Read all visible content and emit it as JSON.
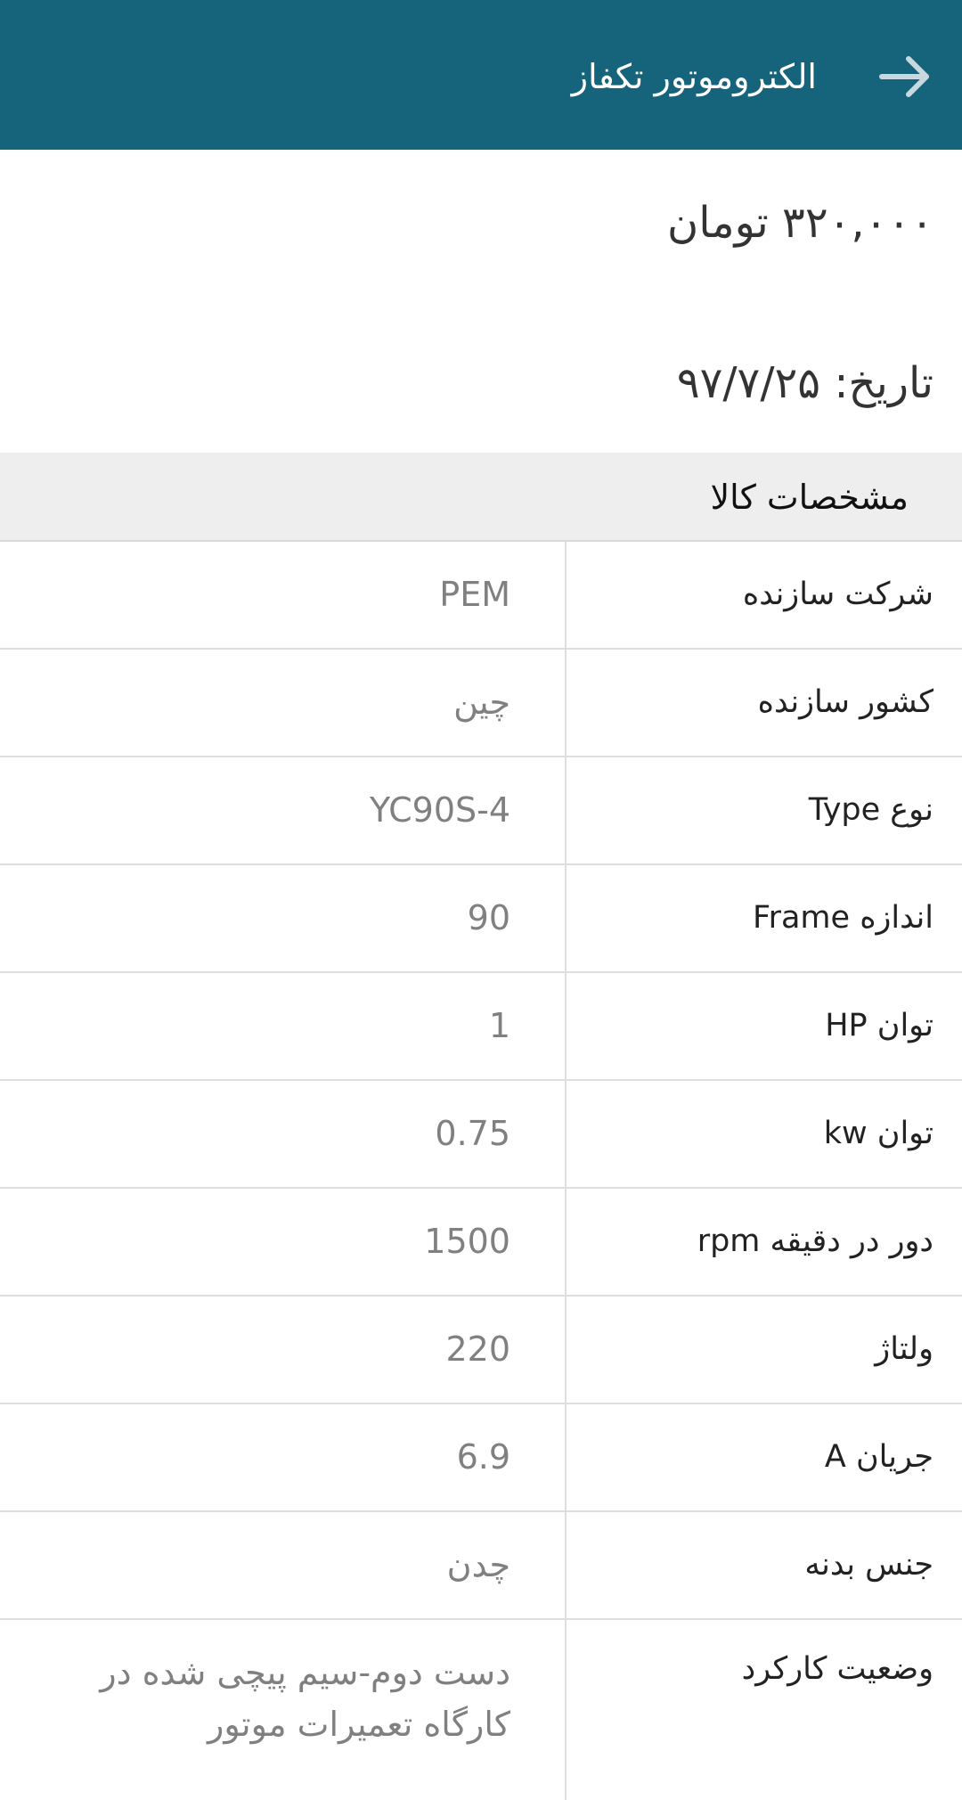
{
  "appbar": {
    "title": "الکتروموتور تکفاز",
    "back_icon": "arrow-right-icon"
  },
  "price": "۳۲۰,۰۰۰ تومان",
  "date": "تاریخ: ۹۷/۷/۲۵",
  "specs": {
    "header": "مشخصات کالا",
    "rows": [
      {
        "label": "شرکت سازنده",
        "value": "PEM"
      },
      {
        "label": "کشور سازنده",
        "value": "چین"
      },
      {
        "label": "نوع Type",
        "value": "YC90S-4"
      },
      {
        "label": "اندازه Frame",
        "value": "90"
      },
      {
        "label": "توان HP",
        "value": "1"
      },
      {
        "label": "توان kw",
        "value": "0.75"
      },
      {
        "label": "دور در دقیقه rpm",
        "value": "1500"
      },
      {
        "label": "ولتاژ",
        "value": "220"
      },
      {
        "label": "جریان A",
        "value": "6.9"
      },
      {
        "label": "جنس بدنه",
        "value": "چدن"
      },
      {
        "label": "وضعیت کارکرد",
        "value": "دست دوم-سیم پیچی شده در کارگاه تعمیرات موتور"
      }
    ]
  },
  "colors": {
    "appbar": "#15647c",
    "header_bg": "#eeeeee",
    "value_text": "#808080"
  }
}
